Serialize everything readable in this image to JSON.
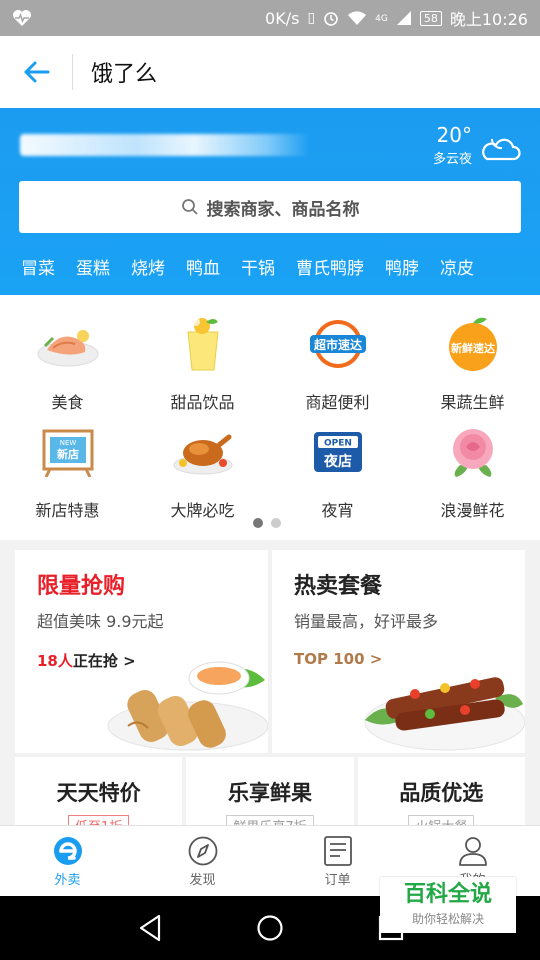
{
  "status_bar": {
    "net_speed": "0K/s",
    "network": "4G",
    "battery": "58",
    "time": "晚上10:26"
  },
  "title_bar": {
    "title": "饿了么"
  },
  "header": {
    "weather": {
      "temp": "20°",
      "condition": "多云夜",
      "icon": "cloud-moon-icon"
    },
    "search": {
      "placeholder": "搜索商家、商品名称"
    },
    "keywords": [
      "冒菜",
      "蛋糕",
      "烧烤",
      "鸭血",
      "干锅",
      "曹氏鸭脖",
      "鸭脖",
      "凉皮"
    ]
  },
  "categories": [
    {
      "label": "美食",
      "icon": "food-plate-icon"
    },
    {
      "label": "甜品饮品",
      "icon": "drink-cup-icon"
    },
    {
      "label": "商超便利",
      "icon": "supermarket-express-icon"
    },
    {
      "label": "果蔬生鲜",
      "icon": "fresh-express-icon"
    },
    {
      "label": "新店特惠",
      "icon": "new-store-icon"
    },
    {
      "label": "大牌必吃",
      "icon": "roast-chicken-icon"
    },
    {
      "label": "夜宵",
      "icon": "night-store-icon"
    },
    {
      "label": "浪漫鲜花",
      "icon": "rose-icon"
    }
  ],
  "category_badges": {
    "supermarket": "超市速达",
    "fresh": "新鲜速达",
    "new_store_top": "NEW",
    "new_store": "新店",
    "night_top": "OPEN",
    "night": "夜店"
  },
  "pager": {
    "pages": 2,
    "current": 1
  },
  "promos": [
    {
      "title": "限量抢购",
      "subtitle": "超值美味 9.9元起",
      "link_count": "18人",
      "link_text": "正在抢 >",
      "title_color": "#e8202a",
      "link_color": "#e8202a"
    },
    {
      "title": "热卖套餐",
      "subtitle": "销量最高，好评最多",
      "link_text": "TOP 100 >",
      "title_color": "#222222",
      "link_color": "#b07a4a"
    }
  ],
  "features": [
    {
      "title": "天天特价",
      "tag": "低至1折"
    },
    {
      "title": "乐享鲜果",
      "tag": "鲜果乐享7折"
    },
    {
      "title": "品质优选",
      "tag": "火锅大餐"
    }
  ],
  "tabs": [
    {
      "label": "外卖",
      "icon": "takeaway-icon",
      "active": true
    },
    {
      "label": "发现",
      "icon": "compass-icon",
      "active": false
    },
    {
      "label": "订单",
      "icon": "order-list-icon",
      "active": false
    },
    {
      "label": "我的",
      "icon": "user-icon",
      "active": false
    }
  ],
  "watermark": {
    "title": "百科全说",
    "subtitle": "助你轻松解决"
  },
  "colors": {
    "brand_blue": "#1a9cf0",
    "promo_red": "#e8202a"
  }
}
